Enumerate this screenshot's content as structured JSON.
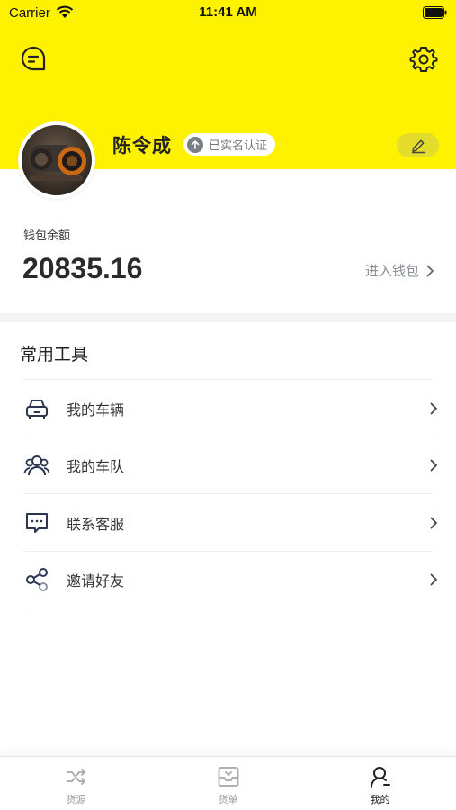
{
  "status_bar": {
    "carrier": "Carrier",
    "time": "11:41 AM"
  },
  "profile": {
    "name": "陈令成",
    "verified_label": "已实名认证"
  },
  "wallet": {
    "label": "钱包余额",
    "amount": "20835.16",
    "link": "进入钱包"
  },
  "tools": {
    "title": "常用工具",
    "items": [
      {
        "label": "我的车辆",
        "icon": "car-icon"
      },
      {
        "label": "我的车队",
        "icon": "team-icon"
      },
      {
        "label": "联系客服",
        "icon": "chat-icon"
      },
      {
        "label": "邀请好友",
        "icon": "share-icon"
      }
    ]
  },
  "tabbar": {
    "items": [
      {
        "label": "货源",
        "icon": "shuffle-icon",
        "active": false
      },
      {
        "label": "货单",
        "icon": "inbox-icon",
        "active": false
      },
      {
        "label": "我的",
        "icon": "user-icon",
        "active": true
      }
    ]
  },
  "colors": {
    "brand_yellow": "#fff200",
    "edit_pill": "#e3dc2a",
    "text_dark": "#222222",
    "text_muted": "#8a8f96"
  }
}
